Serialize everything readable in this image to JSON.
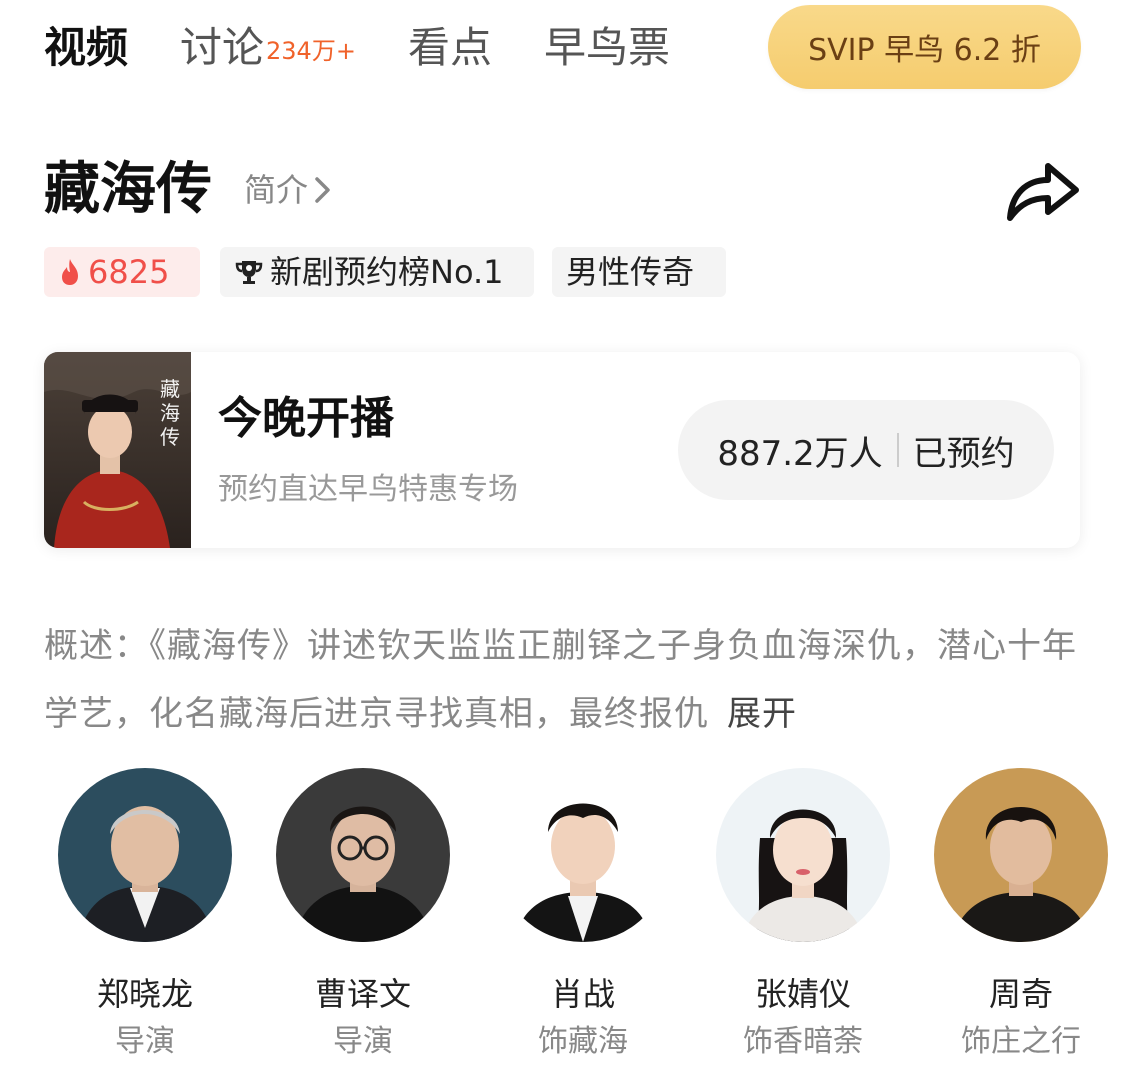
{
  "tabs": [
    {
      "label": "视频",
      "active": true
    },
    {
      "label": "讨论",
      "badge": "234万+"
    },
    {
      "label": "看点"
    },
    {
      "label": "早鸟票"
    }
  ],
  "svip_button": "SVIP 早鸟 6.2 折",
  "show": {
    "title": "藏海传",
    "intro_link": "简介",
    "heat": "6825",
    "rank_tag": "新剧预约榜No.1",
    "genre_tag": "男性传奇"
  },
  "premiere_card": {
    "title": "今晚开播",
    "subtitle": "预约直达早鸟特惠专场",
    "reserve_count": "887.2万人",
    "reserve_label": "已预约"
  },
  "summary": {
    "text": "概述：《藏海传》讲述钦天监监正蒯铎之子身负血海深仇，潜心十年学艺，化名藏海后进京寻找真相，最终报仇",
    "expand_label": "展开"
  },
  "cast": [
    {
      "name": "郑晓龙",
      "role": "导演"
    },
    {
      "name": "曹译文",
      "role": "导演"
    },
    {
      "name": "肖战",
      "role": "饰藏海"
    },
    {
      "name": "张婧仪",
      "role": "饰香暗荼"
    },
    {
      "name": "周奇",
      "role": "饰庄之行"
    }
  ],
  "colors": {
    "accent_orange": "#f0622a",
    "hot_red": "#f04f49",
    "svip_gold": "#f7d27a"
  }
}
